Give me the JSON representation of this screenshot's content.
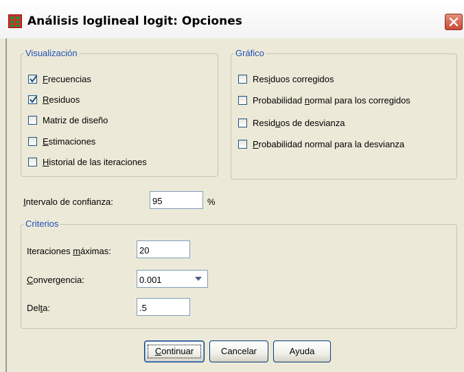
{
  "window": {
    "title": "Análisis loglineal logit: Opciones",
    "close_icon": "close-icon",
    "app_icon": "spss-table-icon"
  },
  "visualizacion": {
    "legend": "Visualización",
    "items": [
      {
        "pre": "",
        "ul": "F",
        "post": "recuencias",
        "checked": true
      },
      {
        "pre": "",
        "ul": "R",
        "post": "esiduos",
        "checked": true
      },
      {
        "pre": "Matriz de diseño",
        "ul": "",
        "post": "",
        "checked": false
      },
      {
        "pre": "",
        "ul": "E",
        "post": "stimaciones",
        "checked": false
      },
      {
        "pre": "",
        "ul": "H",
        "post": "istorial de las iteraciones",
        "checked": false
      }
    ]
  },
  "grafico": {
    "legend": "Gráfico",
    "items": [
      {
        "pre": "Res",
        "ul": "i",
        "post": "duos corregidos",
        "checked": false
      },
      {
        "pre": "Probabilidad ",
        "ul": "n",
        "post": "ormal para los corregidos",
        "checked": false
      },
      {
        "pre": "Resid",
        "ul": "u",
        "post": "os de desvianza",
        "checked": false
      },
      {
        "pre": "",
        "ul": "P",
        "post": "robabilidad normal para la desvianza",
        "checked": false
      }
    ]
  },
  "confidence": {
    "label_ul": "I",
    "label_rest": "ntervalo de confianza:",
    "value": "95",
    "unit": "%"
  },
  "criterios": {
    "legend": "Criterios",
    "max_iter": {
      "pre": "Iteraciones ",
      "ul": "m",
      "post": "áximas:",
      "value": "20"
    },
    "convergence": {
      "pre": "",
      "ul": "C",
      "post": "onvergencia:",
      "value": "0.001"
    },
    "delta": {
      "pre": "Del",
      "ul": "t",
      "post": "a:",
      "value": ".5"
    }
  },
  "buttons": {
    "continue": {
      "ul": "C",
      "rest": "ontinuar"
    },
    "cancel": "Cancelar",
    "help": "Ayuda"
  },
  "colors": {
    "legend": "#1e50b4",
    "dialog_bg": "#ece9d8",
    "close": "#c94b35"
  }
}
